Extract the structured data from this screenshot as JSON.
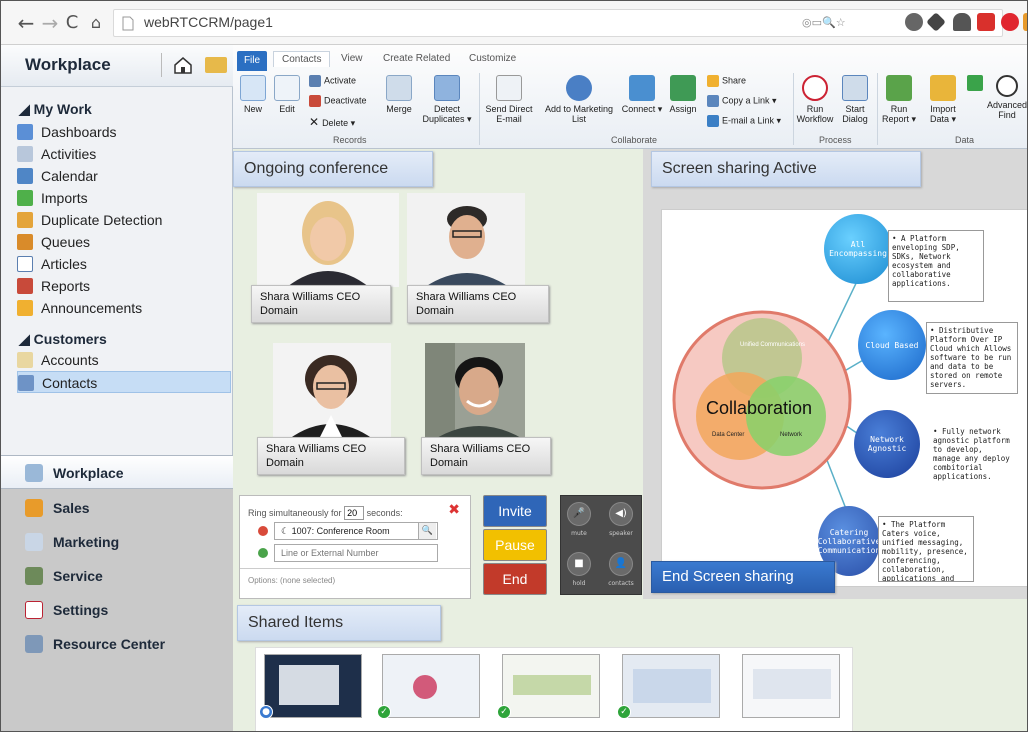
{
  "browser": {
    "url": "webRTCCRM/page1"
  },
  "workplace_header": "Workplace",
  "nav": {
    "groups": [
      {
        "label": "My Work"
      },
      {
        "label": "Customers"
      }
    ],
    "my_work": [
      "Dashboards",
      "Activities",
      "Calendar",
      "Imports",
      "Duplicate Detection",
      "Queues",
      "Articles",
      "Reports",
      "Announcements"
    ],
    "customers": [
      "Accounts",
      "Contacts"
    ],
    "bottom": [
      "Workplace",
      "Sales",
      "Marketing",
      "Service",
      "Settings",
      "Resource Center"
    ]
  },
  "ribbon": {
    "tabs": [
      "File",
      "Contacts",
      "View",
      "Create Related",
      "Customize"
    ],
    "buttons": {
      "new": "New",
      "edit": "Edit",
      "activate": "Activate",
      "deactivate": "Deactivate",
      "delete": "Delete",
      "merge": "Merge",
      "detect": "Detect Duplicates",
      "send": "Send Direct E-mail",
      "addlist": "Add to Marketing List",
      "connect": "Connect",
      "assign": "Assign",
      "share": "Share",
      "copylink": "Copy a Link",
      "emaillink": "E-mail a Link",
      "runwf": "Run Workflow",
      "startdlg": "Start Dialog",
      "runreport": "Run Report",
      "importdata": "Import Data",
      "advfind": "Advanced Find"
    },
    "groups": [
      "Records",
      "Collaborate",
      "Process",
      "Data"
    ]
  },
  "conference": {
    "title": "Ongoing conference",
    "participants": [
      {
        "caption": "Shara Williams CEO Domain"
      },
      {
        "caption": "Shara Williams CEO Domain"
      },
      {
        "caption": "Shara Williams CEO Domain"
      },
      {
        "caption": "Shara Williams CEO Domain"
      }
    ],
    "ring": {
      "prefix": "Ring simultaneously for",
      "seconds_value": "20",
      "suffix": "seconds",
      "line1": "1007: Conference Room",
      "line2_placeholder": "Line or External Number",
      "options": "Options: (none selected)"
    },
    "controls": [
      "Invite",
      "Pause",
      "End"
    ],
    "phone_labels": [
      "mute",
      "speaker",
      "hold",
      "contacts"
    ]
  },
  "screen_share": {
    "title": "Screen sharing Active",
    "end_label": "End Screen sharing",
    "slide": {
      "center": "Collaboration",
      "venn": [
        "Unified Communications",
        "Data Center",
        "Network"
      ],
      "nodes": [
        "All Encompassing",
        "Cloud Based",
        "Network Agnostic",
        "Catering Collaborative Communication"
      ],
      "notes": [
        "• A Platform enveloping SDP, SDKs, Network ecosystem and collaborative applications.",
        "• Distributive Platform Over IP Cloud which Allows software to be run and data to be stored on remote servers.",
        "• Fully network agnostic platform to develop, manage any deploy combitorial applications.",
        "• The Platform Caters voice, unified messaging, mobility, presence, conferencing, collaboration, applications and more."
      ]
    }
  },
  "shared_items": {
    "title": "Shared Items",
    "count": 5
  },
  "colors": {
    "invite": "#2f66b8",
    "pause": "#f2c000",
    "end": "#c23a2a",
    "accent": "#2b6fc2"
  }
}
